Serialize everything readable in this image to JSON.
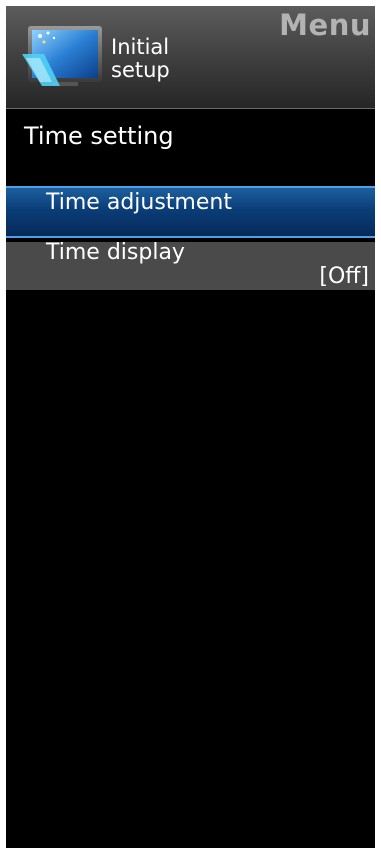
{
  "header": {
    "menu_title": "Menu",
    "label_line1": "Initial",
    "label_line2": "setup",
    "icon": "initial-setup-icon"
  },
  "section": {
    "title": "Time setting"
  },
  "items": [
    {
      "label": "Time adjustment",
      "value": "",
      "selected": true
    },
    {
      "label": "Time display",
      "value": "[Off]",
      "selected": false
    }
  ],
  "colors": {
    "selected_highlight": "#0a3d78",
    "selected_border": "#4ea0e8",
    "item_background": "#4a4a4a",
    "background": "#000000"
  }
}
